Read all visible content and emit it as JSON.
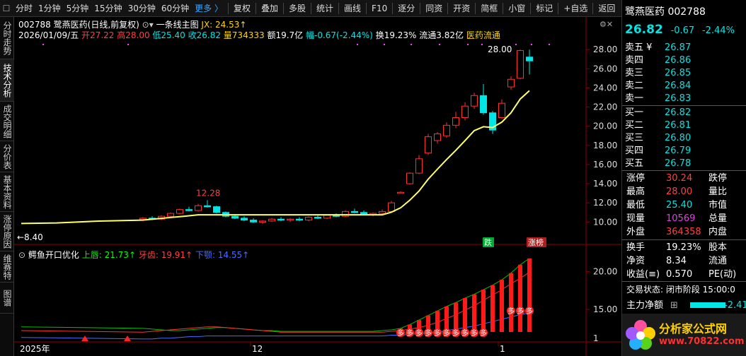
{
  "toolbar": {
    "items": [
      "分时",
      "1分钟",
      "5分钟",
      "15分钟",
      "30分钟",
      "60分钟"
    ],
    "more": "更多 〉",
    "tools": [
      "复权",
      "叠加",
      "多股",
      "统计",
      "画线",
      "F10",
      "逐分",
      "同资",
      "开资",
      "简框",
      "小窗",
      "标记",
      "+自选",
      "返回"
    ]
  },
  "sidebar": [
    "分时走势",
    "技术分析",
    "成交明细",
    "分价表",
    "基本资料",
    "涨停原因",
    "维赛特",
    "图谱"
  ],
  "header": {
    "code": "002788",
    "name_period": "鹭燕医药(日线,前复权)",
    "indicator_name": "一条线主图",
    "jx_label": "JX: 24.53↑",
    "date": "2026/01/09/五",
    "open": "开27.22",
    "high": "高28.00",
    "low": "低25.40",
    "close": "收26.82",
    "volume": "量734333",
    "amount": "额19.7亿",
    "change": "幅-0.67(-2.44%)",
    "turnover": "换19.23%",
    "float": "流通3.82亿",
    "sector": "医药流通"
  },
  "sub_header": {
    "name": "鳄鱼开口优化",
    "upper": "上唇: 21.73↑",
    "teeth": "牙齿: 19.91↑",
    "jaw": "下颚: 14.55↑"
  },
  "chart_labels": {
    "high_mark": "28.00",
    "low_mark": "12.28",
    "low_left": "←8.40",
    "die": "跌",
    "zhangbang": "涨榜",
    "marker_glyph": "多",
    "axis_year": "2025年",
    "axis_month12": "12",
    "axis_month1": "1"
  },
  "chart_data": [
    {
      "type": "candlestick",
      "title": "鹭燕医药(日线,前复权)",
      "ylim": [
        8.4,
        28.9
      ],
      "y_ticks": [
        10.0,
        12.0,
        14.0,
        16.0,
        18.0,
        20.0,
        22.0,
        24.0,
        26.0,
        28.0
      ],
      "candles": [
        {
          "o": 10.3,
          "h": 10.5,
          "l": 10.1,
          "c": 10.4
        },
        {
          "o": 10.4,
          "h": 10.6,
          "l": 10.2,
          "c": 10.3
        },
        {
          "o": 10.3,
          "h": 10.7,
          "l": 10.2,
          "c": 10.6
        },
        {
          "o": 10.6,
          "h": 11.0,
          "l": 10.5,
          "c": 10.9
        },
        {
          "o": 10.9,
          "h": 11.4,
          "l": 10.8,
          "c": 11.3
        },
        {
          "o": 11.3,
          "h": 11.6,
          "l": 11.1,
          "c": 11.2
        },
        {
          "o": 11.2,
          "h": 11.9,
          "l": 11.1,
          "c": 11.7
        },
        {
          "o": 11.7,
          "h": 12.28,
          "l": 11.5,
          "c": 11.6
        },
        {
          "o": 11.6,
          "h": 11.7,
          "l": 10.9,
          "c": 11.0
        },
        {
          "o": 11.0,
          "h": 11.1,
          "l": 10.5,
          "c": 10.6
        },
        {
          "o": 10.6,
          "h": 10.8,
          "l": 10.3,
          "c": 10.4
        },
        {
          "o": 10.4,
          "h": 10.6,
          "l": 10.1,
          "c": 10.2
        },
        {
          "o": 10.2,
          "h": 10.4,
          "l": 9.9,
          "c": 10.0
        },
        {
          "o": 10.0,
          "h": 10.2,
          "l": 9.8,
          "c": 10.1
        },
        {
          "o": 10.1,
          "h": 10.4,
          "l": 10.0,
          "c": 10.3
        },
        {
          "o": 10.3,
          "h": 10.5,
          "l": 10.1,
          "c": 10.2
        },
        {
          "o": 10.2,
          "h": 10.4,
          "l": 10.0,
          "c": 10.3
        },
        {
          "o": 10.3,
          "h": 10.5,
          "l": 10.1,
          "c": 10.2
        },
        {
          "o": 10.2,
          "h": 10.6,
          "l": 10.1,
          "c": 10.5
        },
        {
          "o": 10.5,
          "h": 10.7,
          "l": 10.3,
          "c": 10.4
        },
        {
          "o": 10.4,
          "h": 10.8,
          "l": 10.3,
          "c": 10.7
        },
        {
          "o": 10.7,
          "h": 10.9,
          "l": 10.5,
          "c": 10.6
        },
        {
          "o": 10.6,
          "h": 11.2,
          "l": 10.5,
          "c": 11.1
        },
        {
          "o": 11.1,
          "h": 11.4,
          "l": 10.9,
          "c": 11.0
        },
        {
          "o": 11.0,
          "h": 11.2,
          "l": 10.7,
          "c": 10.8
        },
        {
          "o": 10.8,
          "h": 11.0,
          "l": 10.6,
          "c": 10.9
        },
        {
          "o": 10.9,
          "h": 11.3,
          "l": 10.8,
          "c": 11.1
        },
        {
          "o": 11.1,
          "h": 12.2,
          "l": 11.0,
          "c": 12.0
        },
        {
          "o": 13.1,
          "h": 13.2,
          "l": 13.0,
          "c": 13.1
        },
        {
          "o": 14.0,
          "h": 15.2,
          "l": 13.9,
          "c": 15.1
        },
        {
          "o": 15.1,
          "h": 17.0,
          "l": 15.0,
          "c": 16.6
        },
        {
          "o": 17.2,
          "h": 19.2,
          "l": 17.0,
          "c": 18.9
        },
        {
          "o": 18.5,
          "h": 19.4,
          "l": 18.2,
          "c": 19.2
        },
        {
          "o": 19.0,
          "h": 20.4,
          "l": 18.8,
          "c": 20.1
        },
        {
          "o": 20.1,
          "h": 21.5,
          "l": 19.8,
          "c": 20.9
        },
        {
          "o": 20.9,
          "h": 22.5,
          "l": 20.6,
          "c": 22.1
        },
        {
          "o": 22.1,
          "h": 23.5,
          "l": 21.8,
          "c": 23.2
        },
        {
          "o": 23.2,
          "h": 24.4,
          "l": 21.2,
          "c": 21.4
        },
        {
          "o": 21.4,
          "h": 21.6,
          "l": 19.2,
          "c": 19.6
        },
        {
          "o": 20.9,
          "h": 22.8,
          "l": 20.8,
          "c": 22.4
        },
        {
          "o": 24.1,
          "h": 25.2,
          "l": 23.8,
          "c": 24.9
        },
        {
          "o": 25.0,
          "h": 28.0,
          "l": 24.9,
          "c": 27.9
        },
        {
          "o": 27.22,
          "h": 28.0,
          "l": 25.4,
          "c": 26.82
        }
      ]
    },
    {
      "type": "line",
      "title": "鳄鱼开口优化",
      "ylim": [
        10.9,
        21.9
      ],
      "y_ticks": [
        15.0,
        20.0
      ],
      "series": [
        {
          "name": "上唇",
          "values": [
            12.5,
            12.4,
            12.3,
            12.2,
            12.2,
            12.3,
            12.4,
            12.5,
            12.6,
            12.6,
            12.5,
            12.4,
            12.3,
            12.2,
            12.2,
            12.1,
            12.1,
            12.1,
            12.1,
            12.1,
            12.1,
            12.1,
            12.1,
            12.1,
            12.1,
            12.1,
            12.2,
            12.3,
            12.5,
            13.0,
            13.6,
            14.2,
            14.8,
            15.4,
            15.9,
            16.5,
            17.0,
            17.6,
            18.2,
            18.9,
            19.8,
            20.9,
            21.73
          ]
        },
        {
          "name": "牙齿",
          "values": [
            12.0,
            12.1,
            12.2,
            12.3,
            12.4,
            12.5,
            12.6,
            12.7,
            12.7,
            12.6,
            12.5,
            12.4,
            12.3,
            12.2,
            12.1,
            12.0,
            12.0,
            12.0,
            12.0,
            12.0,
            12.0,
            12.0,
            12.0,
            12.0,
            12.0,
            12.0,
            12.0,
            12.1,
            12.2,
            12.4,
            12.6,
            12.9,
            13.3,
            13.8,
            14.3,
            14.9,
            15.5,
            16.2,
            16.9,
            17.6,
            18.4,
            19.1,
            19.91
          ]
        },
        {
          "name": "下颚",
          "values": [
            11.1,
            11.1,
            11.2,
            11.2,
            11.3,
            11.4,
            11.4,
            11.5,
            11.5,
            11.5,
            11.5,
            11.5,
            11.5,
            11.5,
            11.5,
            11.5,
            11.5,
            11.5,
            11.5,
            11.5,
            11.5,
            11.5,
            11.5,
            11.5,
            11.5,
            11.5,
            11.5,
            11.6,
            11.6,
            11.7,
            11.8,
            11.9,
            12.0,
            12.2,
            12.4,
            12.6,
            12.8,
            13.1,
            13.4,
            13.7,
            14.0,
            14.3,
            14.55
          ]
        }
      ]
    }
  ],
  "right_panel": {
    "stock_name": "鹭燕医药",
    "stock_code": "002788",
    "price": "26.82",
    "change": "-0.67",
    "change_pct": "-2.44%",
    "asks": [
      {
        "label": "卖五 ¥",
        "price": "26.87"
      },
      {
        "label": "卖四",
        "price": "26.86"
      },
      {
        "label": "卖三",
        "price": "26.85"
      },
      {
        "label": "卖二",
        "price": "26.84"
      },
      {
        "label": "卖一",
        "price": "26.83"
      }
    ],
    "bids": [
      {
        "label": "买一",
        "price": "26.82"
      },
      {
        "label": "买二",
        "price": "26.81"
      },
      {
        "label": "买三",
        "price": "26.80"
      },
      {
        "label": "买四",
        "price": "26.79"
      },
      {
        "label": "买五",
        "price": "26.78"
      }
    ],
    "stats1": [
      {
        "k": "涨停",
        "v": "30.24",
        "k2": "跌停"
      },
      {
        "k": "最高",
        "v": "28.00",
        "k2": "量比"
      },
      {
        "k": "最低",
        "v": "25.40",
        "k2": "市值"
      },
      {
        "k": "现量",
        "v": "10569",
        "k2": "总量"
      },
      {
        "k": "外盘",
        "v": "364358",
        "k2": "内盘"
      }
    ],
    "stats2": [
      {
        "k": "换手",
        "v": "19.23%",
        "k2": "股本"
      },
      {
        "k": "净资",
        "v": "8.34",
        "k2": "流通"
      },
      {
        "k": "收益(≡)",
        "v": "0.570",
        "k2": "PE(动)"
      }
    ],
    "trade_status": "交易状态: 闭市阶段 15:00:0",
    "main_flow_label": "主力净额",
    "main_flow_value": "-2.41",
    "logo_text": "分析家公式网",
    "logo_url": "www.70822.com"
  }
}
